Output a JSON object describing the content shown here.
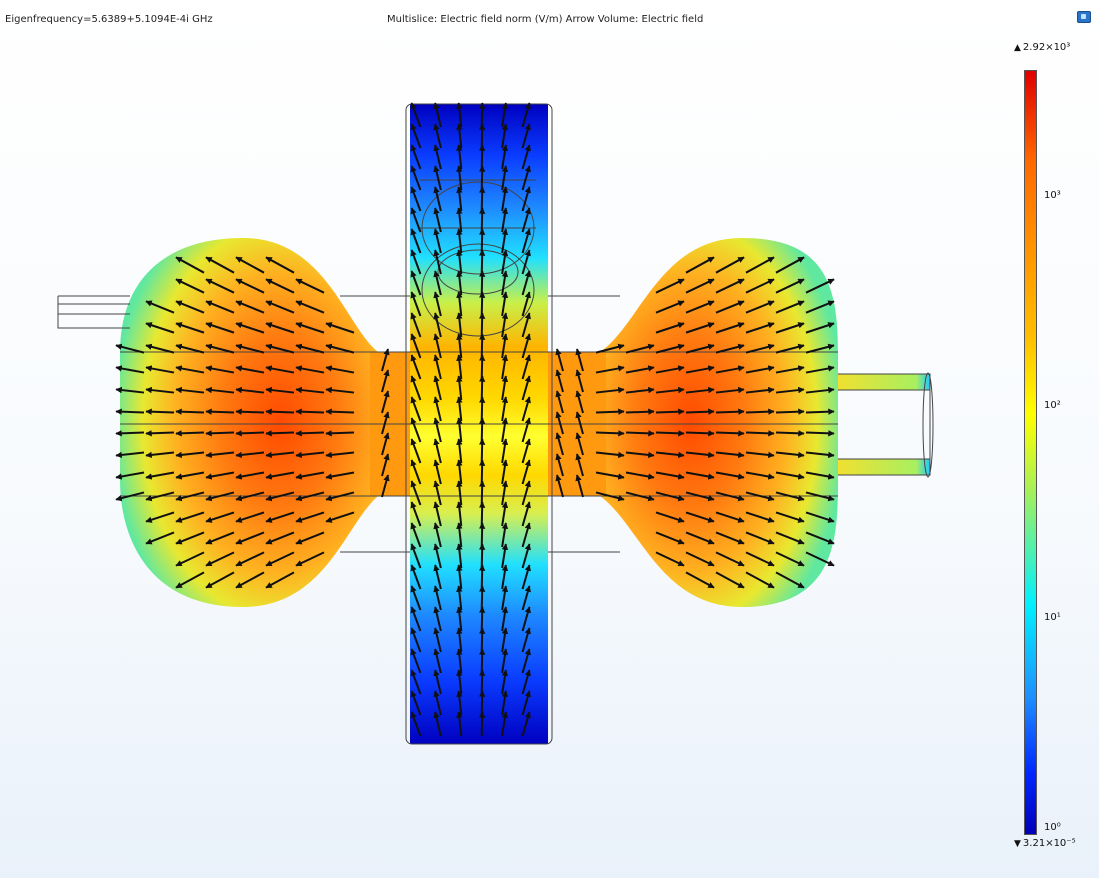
{
  "header": {
    "eigenfrequency": "Eigenfrequency=5.6389+5.1094E-4i GHz",
    "plot_title": "Multislice: Electric field norm (V/m)  Arrow Volume: Electric field"
  },
  "colorbar": {
    "max_label": "2.92×10³",
    "min_label": "3.21×10⁻⁵",
    "ticks": [
      "10³",
      "10²",
      "10¹",
      "10⁰"
    ],
    "colors": [
      "#e00000",
      "#ff6a00",
      "#ffff00",
      "#00f0ff",
      "#0028ff",
      "#0000b8"
    ]
  },
  "icons": {
    "corner": "window-icon",
    "max_marker": "triangle-up-icon",
    "min_marker": "triangle-down-icon"
  }
}
